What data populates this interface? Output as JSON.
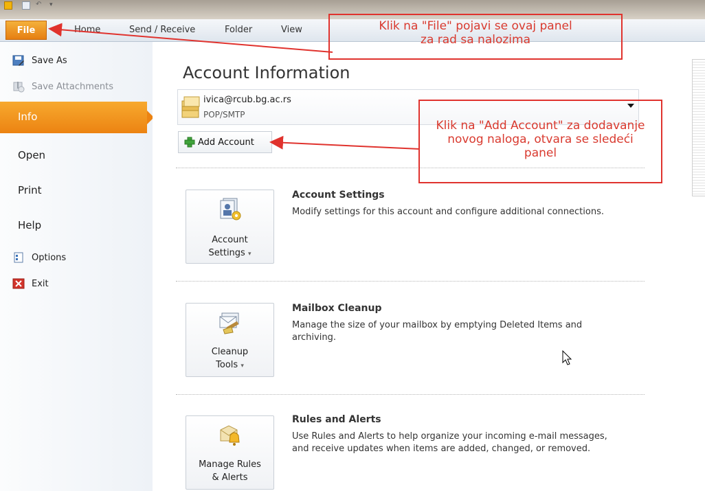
{
  "ribbon": {
    "file_tab": "File",
    "tabs": [
      "Home",
      "Send / Receive",
      "Folder",
      "View"
    ]
  },
  "sidebar": {
    "save_as": "Save As",
    "save_attachments": "Save Attachments",
    "info": "Info",
    "open": "Open",
    "print": "Print",
    "help": "Help",
    "options": "Options",
    "exit": "Exit"
  },
  "account": {
    "title": "Account Information",
    "email": "ivica@rcub.bg.ac.rs",
    "type": "POP/SMTP",
    "add_account": "Add Account"
  },
  "sections": [
    {
      "button_line1": "Account",
      "button_line2": "Settings",
      "title": "Account Settings",
      "description": "Modify settings for this account and configure additional connections."
    },
    {
      "button_line1": "Cleanup",
      "button_line2": "Tools",
      "title": "Mailbox Cleanup",
      "description": "Manage the size of your mailbox by emptying Deleted Items and archiving."
    },
    {
      "button_line1": "Manage Rules",
      "button_line2": "& Alerts",
      "title": "Rules and Alerts",
      "description": "Use Rules and Alerts to help organize your incoming e-mail messages, and receive updates when items are added, changed, or removed."
    }
  ],
  "annotations": {
    "file_note": "Klik na \"File\" pojavi se ovaj panel za rad sa nalozima",
    "add_note": "Klik na \"Add Account\" za dodavanje novog naloga, otvara se sledeći panel"
  },
  "colors": {
    "accent_orange": "#ec8312",
    "annotation_red": "#e0322d"
  }
}
